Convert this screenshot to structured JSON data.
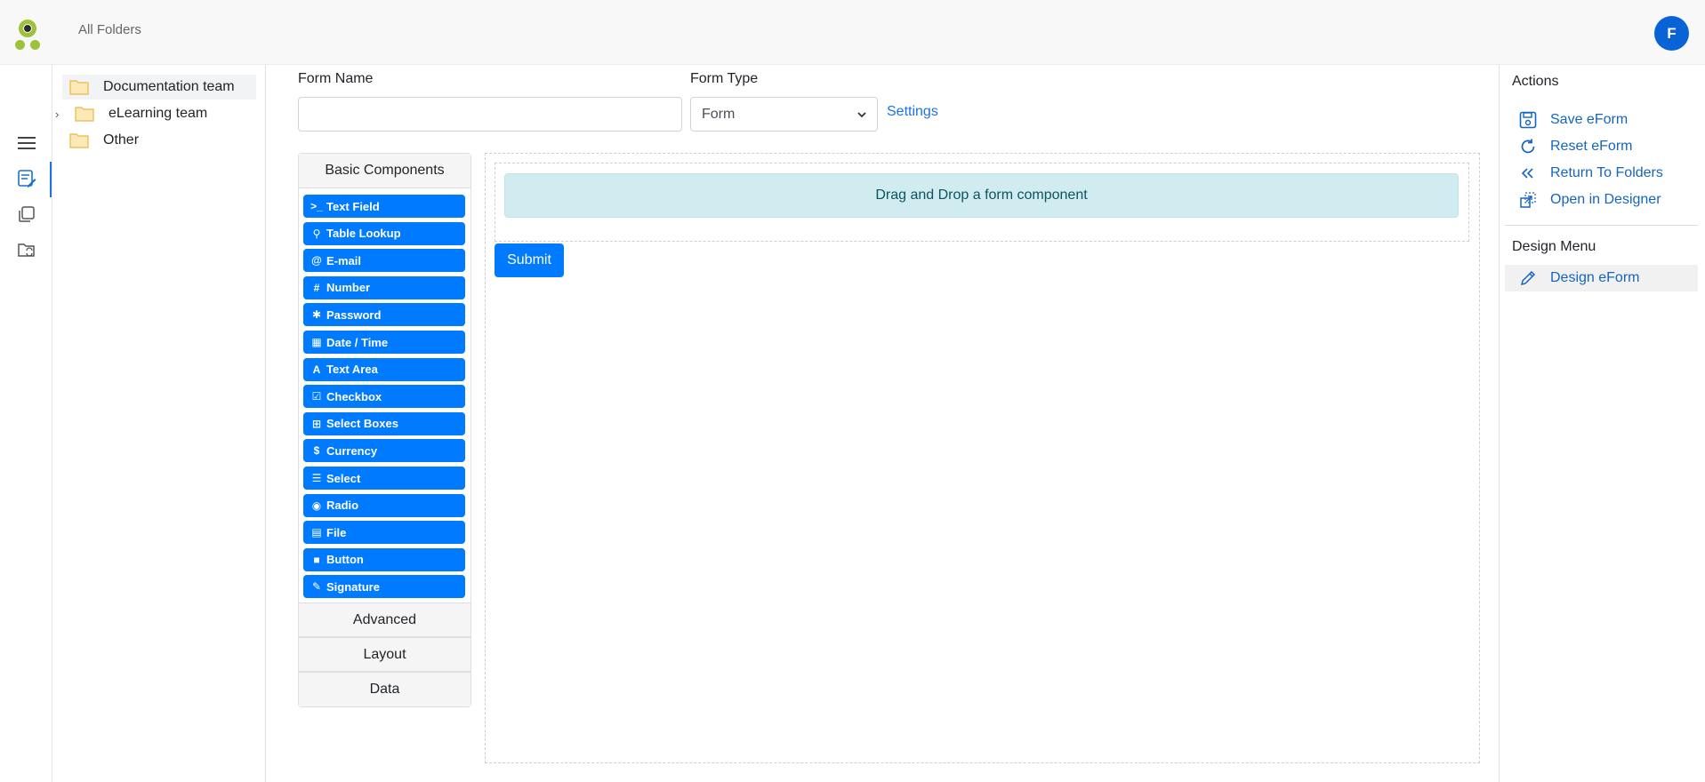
{
  "header": {
    "breadcrumb": "All Folders",
    "avatar_initial": "F"
  },
  "rail": {
    "icons": [
      "menu-icon",
      "form-edit-icon",
      "copy-icon",
      "folder-sync-icon"
    ]
  },
  "folders": {
    "items": [
      {
        "label": "Documentation team",
        "selected": true,
        "expandable": false
      },
      {
        "label": "eLearning team",
        "selected": false,
        "expandable": true
      },
      {
        "label": "Other",
        "selected": false,
        "expandable": false
      }
    ]
  },
  "form": {
    "name_label": "Form Name",
    "name_value": "",
    "type_label": "Form Type",
    "type_value": "Form",
    "settings_label": "Settings"
  },
  "palette": {
    "basic_header": "Basic Components",
    "components": [
      {
        "icon": ">_",
        "label": "Text Field"
      },
      {
        "icon": "⚲",
        "label": "Table Lookup"
      },
      {
        "icon": "@",
        "label": "E-mail"
      },
      {
        "icon": "#",
        "label": "Number"
      },
      {
        "icon": "✱",
        "label": "Password"
      },
      {
        "icon": "▦",
        "label": "Date / Time"
      },
      {
        "icon": "A",
        "label": "Text Area"
      },
      {
        "icon": "☑",
        "label": "Checkbox"
      },
      {
        "icon": "⊞",
        "label": "Select Boxes"
      },
      {
        "icon": "$",
        "label": "Currency"
      },
      {
        "icon": "☰",
        "label": "Select"
      },
      {
        "icon": "◉",
        "label": "Radio"
      },
      {
        "icon": "▤",
        "label": "File"
      },
      {
        "icon": "■",
        "label": "Button"
      },
      {
        "icon": "✎",
        "label": "Signature"
      }
    ],
    "groups": [
      "Advanced",
      "Layout",
      "Data"
    ]
  },
  "canvas": {
    "drop_text": "Drag and Drop a form component",
    "submit_label": "Submit"
  },
  "actions": {
    "title": "Actions",
    "items": [
      {
        "label": "Save eForm",
        "icon": "save-icon"
      },
      {
        "label": "Reset eForm",
        "icon": "reset-icon"
      },
      {
        "label": "Return To Folders",
        "icon": "return-icon"
      },
      {
        "label": "Open in Designer",
        "icon": "open-designer-icon"
      }
    ]
  },
  "design_menu": {
    "title": "Design Menu",
    "item_label": "Design eForm"
  },
  "colors": {
    "primary": "#007bff",
    "link": "#1a73e8",
    "alert_bg": "#d1ecf1",
    "avatar": "#0a63d6",
    "folder": "#f3c969"
  }
}
